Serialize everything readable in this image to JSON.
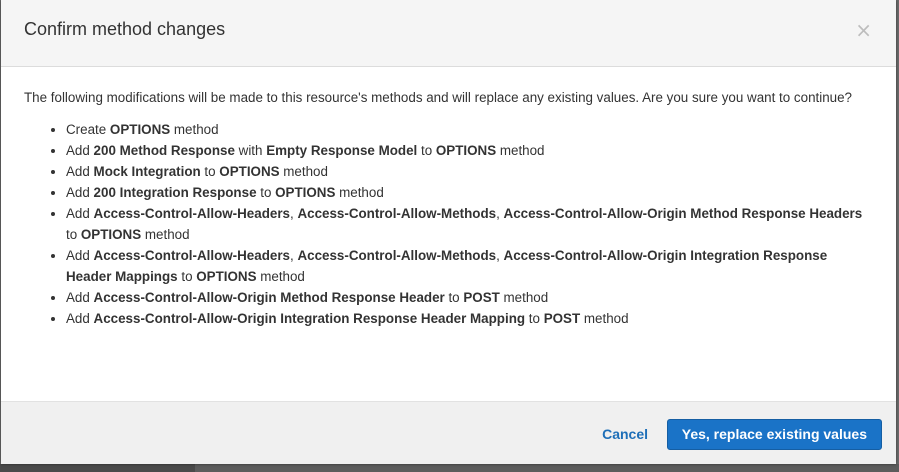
{
  "modal": {
    "title": "Confirm method changes",
    "close_glyph": "×",
    "intro": "The following modifications will be made to this resource's methods and will replace any existing values. Are you sure you want to continue?",
    "changes": [
      [
        {
          "t": "Create "
        },
        {
          "t": "OPTIONS",
          "b": true
        },
        {
          "t": " method"
        }
      ],
      [
        {
          "t": "Add "
        },
        {
          "t": "200 Method Response",
          "b": true
        },
        {
          "t": " with "
        },
        {
          "t": "Empty Response Model",
          "b": true
        },
        {
          "t": " to "
        },
        {
          "t": "OPTIONS",
          "b": true
        },
        {
          "t": " method"
        }
      ],
      [
        {
          "t": "Add "
        },
        {
          "t": "Mock Integration",
          "b": true
        },
        {
          "t": " to "
        },
        {
          "t": "OPTIONS",
          "b": true
        },
        {
          "t": " method"
        }
      ],
      [
        {
          "t": "Add "
        },
        {
          "t": "200 Integration Response",
          "b": true
        },
        {
          "t": " to "
        },
        {
          "t": "OPTIONS",
          "b": true
        },
        {
          "t": " method"
        }
      ],
      [
        {
          "t": "Add "
        },
        {
          "t": "Access-Control-Allow-Headers",
          "b": true
        },
        {
          "t": ", "
        },
        {
          "t": "Access-Control-Allow-Methods",
          "b": true
        },
        {
          "t": ", "
        },
        {
          "t": "Access-Control-Allow-Origin Method Response Headers",
          "b": true
        },
        {
          "t": " to "
        },
        {
          "t": "OPTIONS",
          "b": true
        },
        {
          "t": " method"
        }
      ],
      [
        {
          "t": "Add "
        },
        {
          "t": "Access-Control-Allow-Headers",
          "b": true
        },
        {
          "t": ", "
        },
        {
          "t": "Access-Control-Allow-Methods",
          "b": true
        },
        {
          "t": ", "
        },
        {
          "t": "Access-Control-Allow-Origin Integration Response Header Mappings",
          "b": true
        },
        {
          "t": " to "
        },
        {
          "t": "OPTIONS",
          "b": true
        },
        {
          "t": " method"
        }
      ],
      [
        {
          "t": "Add "
        },
        {
          "t": "Access-Control-Allow-Origin Method Response Header",
          "b": true
        },
        {
          "t": " to "
        },
        {
          "t": "POST",
          "b": true
        },
        {
          "t": " method"
        }
      ],
      [
        {
          "t": "Add "
        },
        {
          "t": "Access-Control-Allow-Origin Integration Response Header Mapping",
          "b": true
        },
        {
          "t": " to "
        },
        {
          "t": "POST",
          "b": true
        },
        {
          "t": " method"
        }
      ]
    ],
    "cancel_label": "Cancel",
    "confirm_label": "Yes, replace existing values"
  },
  "colors": {
    "primary": "#1a73c7",
    "link": "#1e6fb8",
    "header_bg": "#f5f5f5",
    "footer_bg": "#f0f0f0"
  }
}
